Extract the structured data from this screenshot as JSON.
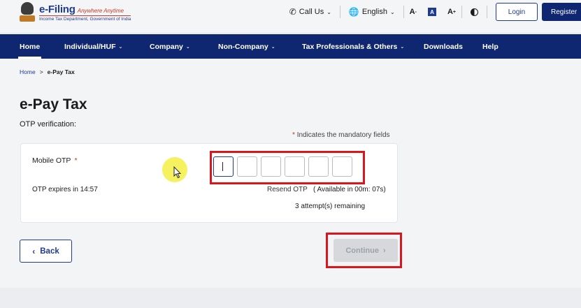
{
  "header": {
    "logo_title": "e-Filing",
    "logo_tagline": "Anywhere Anytime",
    "logo_subtitle": "Income Tax Department, Government of India",
    "call_us": "Call Us",
    "language": "English",
    "font_decrease": "A",
    "font_default": "A",
    "font_increase": "A",
    "login": "Login",
    "register": "Register"
  },
  "nav": {
    "items": [
      {
        "label": "Home"
      },
      {
        "label": "Individual/HUF"
      },
      {
        "label": "Company"
      },
      {
        "label": "Non-Company"
      },
      {
        "label": "Tax Professionals & Others"
      },
      {
        "label": "Downloads"
      },
      {
        "label": "Help"
      }
    ]
  },
  "breadcrumb": {
    "home": "Home",
    "separator": ">",
    "current": "e-Pay Tax"
  },
  "page": {
    "title": "e-Pay Tax",
    "subtitle": "OTP verification:",
    "mandatory_star": "*",
    "mandatory_note": "Indicates the mandatory fields"
  },
  "otp": {
    "label": "Mobile OTP",
    "required_mark": "*",
    "expires": "OTP expires in 14:57",
    "resend": "Resend OTP",
    "available": "( Available in 00m: 07s)",
    "attempts": "3 attempt(s) remaining"
  },
  "actions": {
    "back": "Back",
    "continue": "Continue"
  },
  "colors": {
    "nav_bg": "#0f2771",
    "primary": "#1f3a93",
    "highlight": "#d9161d",
    "disabled": "#d6d8dc"
  }
}
